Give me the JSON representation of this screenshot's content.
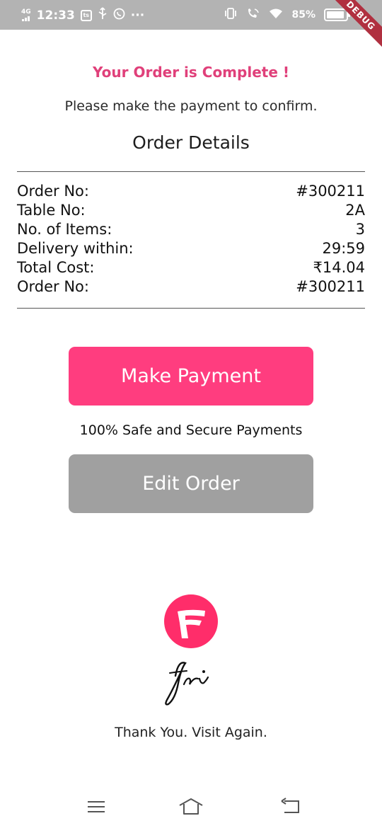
{
  "status_bar": {
    "network": "4G",
    "time": "12:33",
    "app_badge": "ts",
    "more": "···",
    "battery": "85%"
  },
  "debug_banner": "DEBUG",
  "order": {
    "complete_title": "Your Order is Complete !",
    "instruction": "Please make the payment to confirm.",
    "details_heading": "Order Details",
    "rows": [
      {
        "label": "Order No:",
        "value": "#300211"
      },
      {
        "label": "Table No:",
        "value": "2A"
      },
      {
        "label": "No. of Items:",
        "value": "3"
      },
      {
        "label": "Delivery within:",
        "value": "29:59"
      },
      {
        "label": "Total Cost:",
        "value": "₹14.04"
      },
      {
        "label": "Order No:",
        "value": "#300211"
      }
    ]
  },
  "actions": {
    "pay_label": "Make Payment",
    "secure_note": "100% Safe and Secure Payments",
    "edit_label": "Edit Order"
  },
  "footer": {
    "thanks": "Thank You. Visit Again."
  },
  "colors": {
    "accent": "#ff3d7f",
    "title": "#e0407a",
    "disabled": "#a0a0a0"
  },
  "icons": {
    "logo": "fri-logo-icon",
    "nav_menu": "menu-icon",
    "nav_home": "home-icon",
    "nav_back": "back-icon"
  }
}
